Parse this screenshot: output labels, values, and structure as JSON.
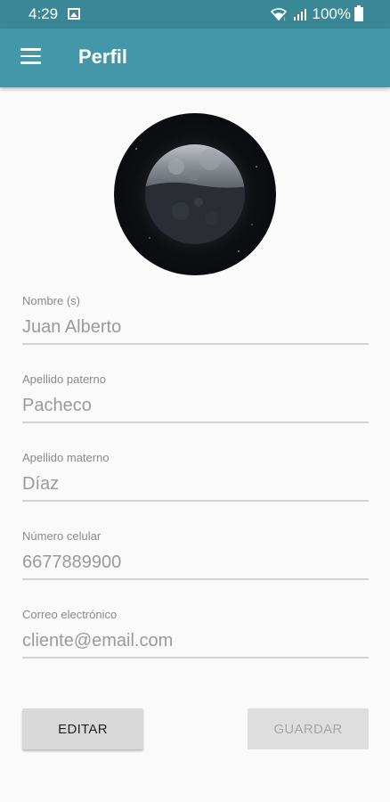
{
  "status_bar": {
    "time": "4:29",
    "battery": "100%",
    "icons": [
      "photo-icon",
      "wifi-icon",
      "signal-icon",
      "battery-icon"
    ]
  },
  "app_bar": {
    "title": "Perfil",
    "menu_icon": "menu-icon",
    "color": "#4298a8"
  },
  "profile": {
    "avatar": "moon-avatar"
  },
  "form": {
    "first_name": {
      "label": "Nombre (s)",
      "value": "Juan Alberto"
    },
    "paternal_surname": {
      "label": "Apellido paterno",
      "value": "Pacheco"
    },
    "maternal_surname": {
      "label": "Apellido materno",
      "value": "Díaz"
    },
    "phone": {
      "label": "Número celular",
      "value": "6677889900"
    },
    "email": {
      "label": "Correo electrónico",
      "value": "cliente@email.com"
    }
  },
  "actions": {
    "edit_label": "EDITAR",
    "save_label": "GUARDAR",
    "save_enabled": false
  }
}
